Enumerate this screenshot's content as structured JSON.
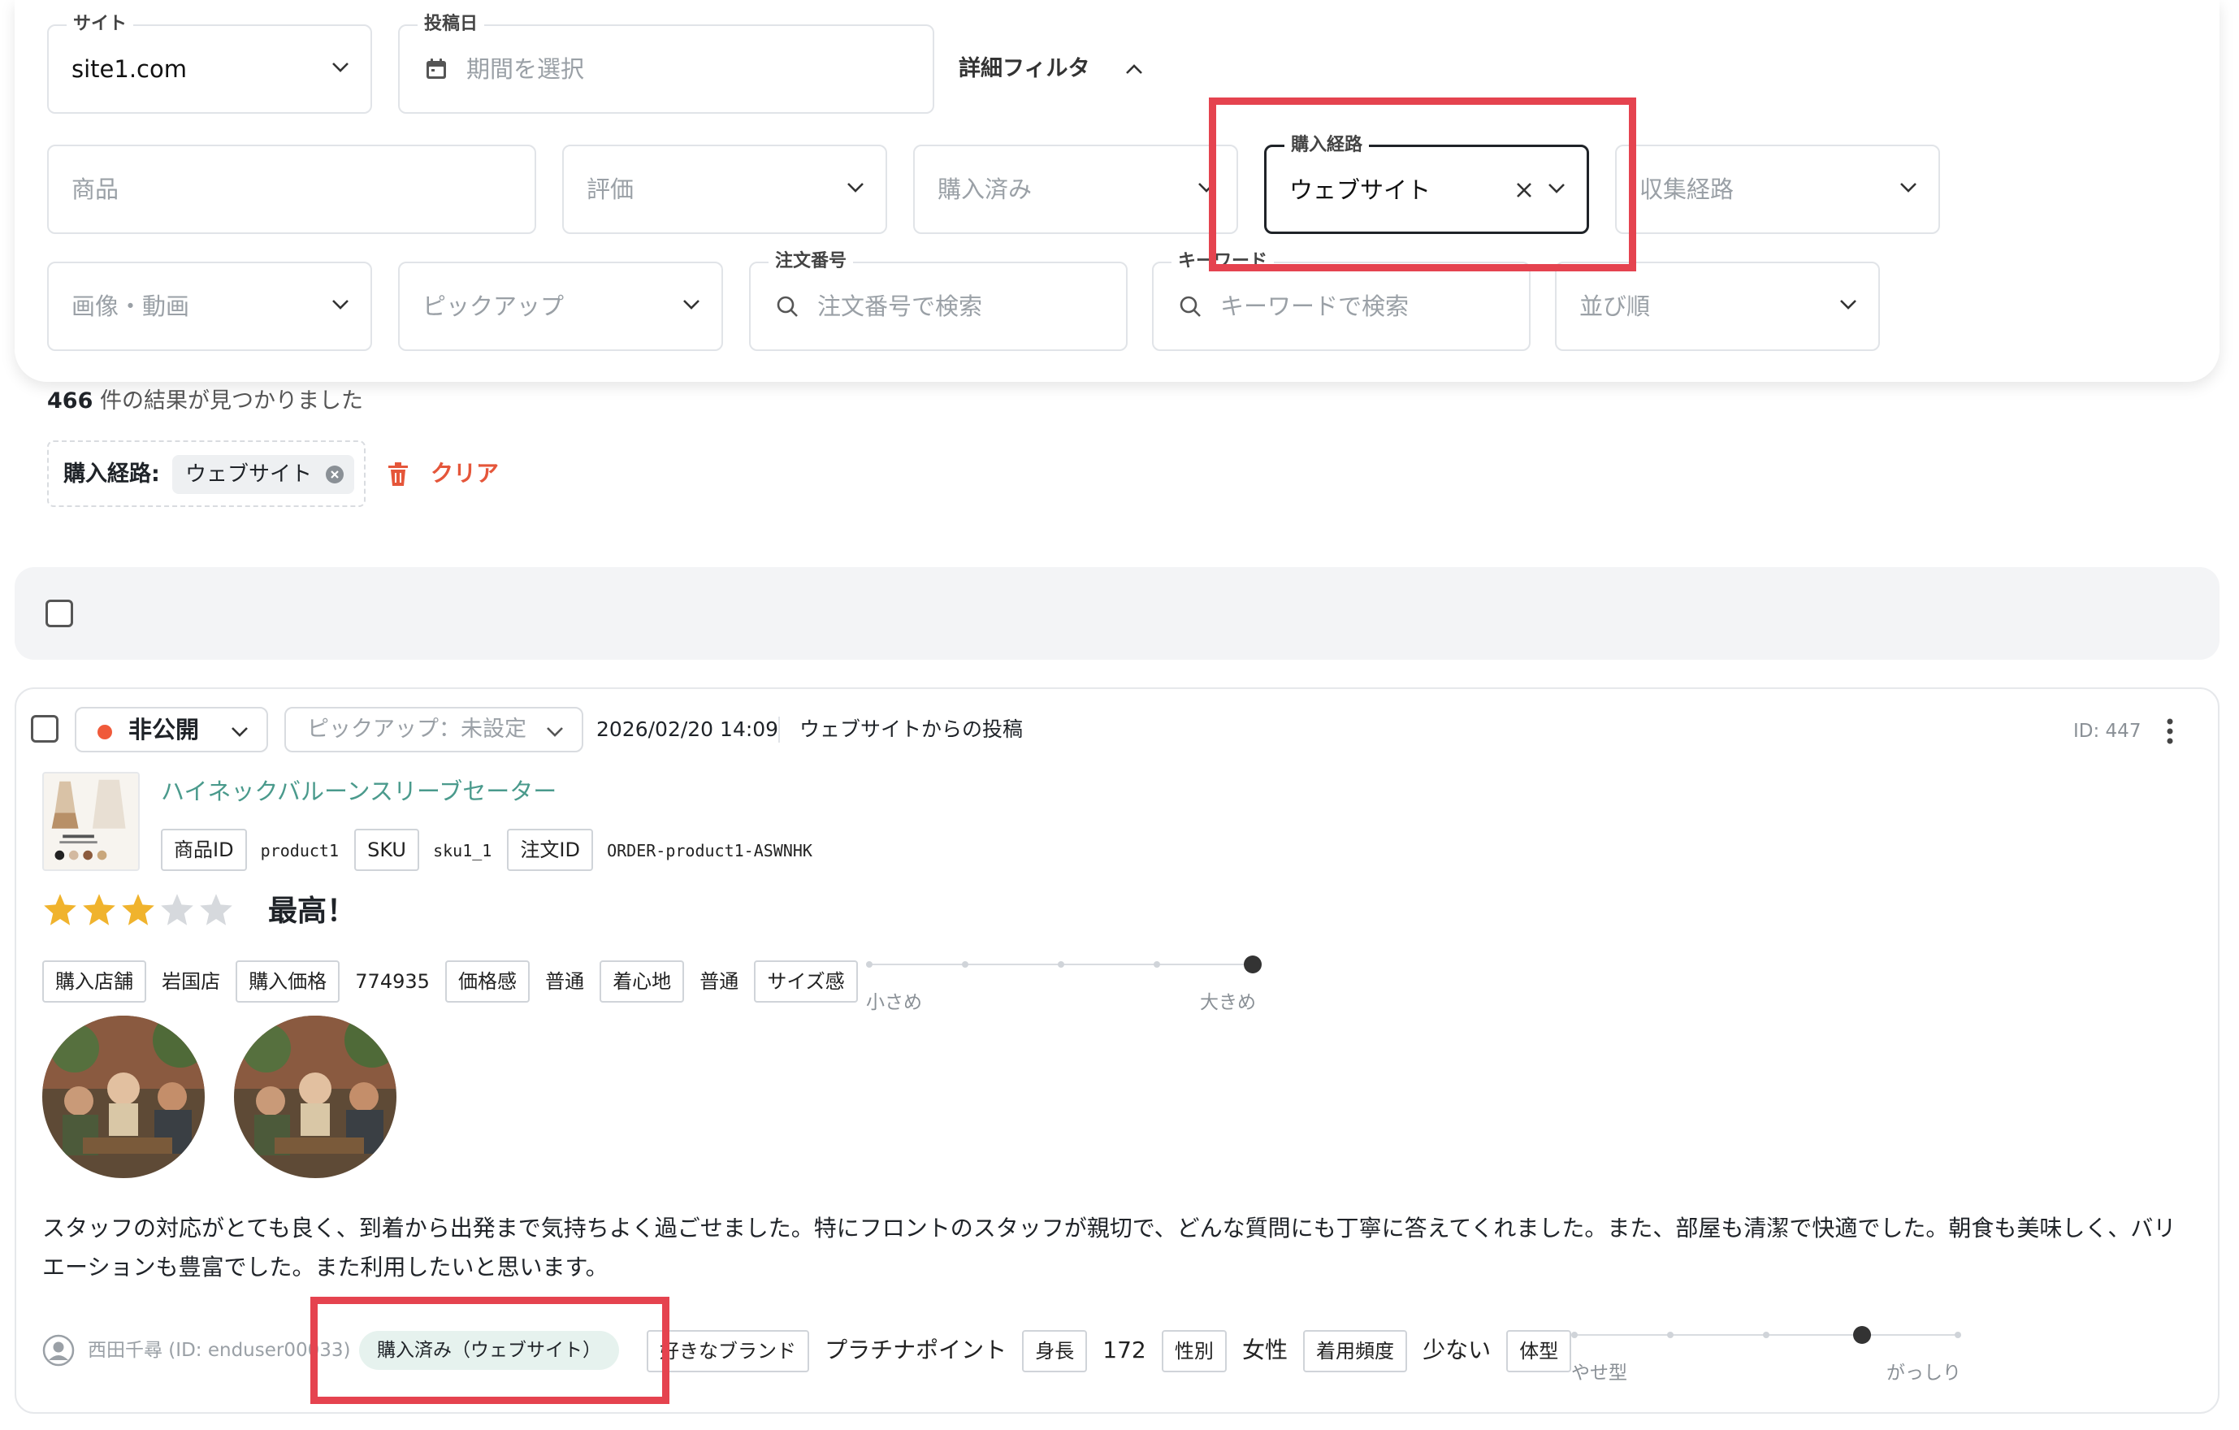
{
  "filters": {
    "site": {
      "label": "サイト",
      "value": "site1.com"
    },
    "posted_date": {
      "label": "投稿日",
      "placeholder": "期間を選択"
    },
    "advanced_toggle": "詳細フィルタ",
    "product": {
      "placeholder": "商品"
    },
    "rating": {
      "placeholder": "評価"
    },
    "purchased": {
      "placeholder": "購入済み"
    },
    "purchase_route": {
      "label": "購入経路",
      "value": "ウェブサイト"
    },
    "collection_route": {
      "placeholder": "収集経路"
    },
    "media": {
      "placeholder": "画像・動画"
    },
    "pickup": {
      "placeholder": "ピックアップ"
    },
    "order_number": {
      "label": "注文番号",
      "placeholder": "注文番号で検索"
    },
    "keyword": {
      "label": "キーワード",
      "placeholder": "キーワードで検索"
    },
    "sort": {
      "placeholder": "並び順"
    }
  },
  "results": {
    "count": "466",
    "suffix": "件の結果が見つかりました"
  },
  "active_filters": {
    "label": "購入経路:",
    "chip": "ウェブサイト",
    "clear": "クリア"
  },
  "review": {
    "status": "非公開",
    "pickup": "ピックアップ：未設定",
    "datetime": "2026/02/20 14:09",
    "source": "ウェブサイトからの投稿",
    "id": "ID: 447",
    "product_name": "ハイネックバルーンスリーブセーター",
    "meta": [
      {
        "key": "商品ID",
        "value": "product1"
      },
      {
        "key": "SKU",
        "value": "sku1_1"
      },
      {
        "key": "注文ID",
        "value": "ORDER-product1-ASWNHK"
      }
    ],
    "rating": 3,
    "rating_max": 5,
    "title": "最高！",
    "attributes": [
      {
        "key": "購入店舗",
        "value": "岩国店"
      },
      {
        "key": "購入価格",
        "value": "774935"
      },
      {
        "key": "価格感",
        "value": "普通"
      },
      {
        "key": "着心地",
        "value": "普通"
      }
    ],
    "size_scale": {
      "label": "サイズ感",
      "min": "小さめ",
      "max": "大きめ",
      "position": 5,
      "steps": 5
    },
    "body_line1": "スタッフの対応がとても良く、到着から出発まで気持ちよく過ごせました。特にフロントのスタッフが親切で、どんな質問にも丁寧に答えてくれました。また、部屋も清潔で快適でした。朝食も美味しく、バリ",
    "body_line2": "エーションも豊富でした。また利用したいと思います。",
    "user": "西田千尋 (ID: enduser00033)",
    "purchase_badge": "購入済み（ウェブサイト）",
    "favorite_brand": "好きなブランド",
    "favorite_brand_value": "プラチナポイント",
    "height_label": "身長",
    "height_value": "172",
    "gender_label": "性別",
    "gender_value": "女性",
    "freq_label": "着用頻度",
    "freq_value": "少ない",
    "body_type": {
      "label": "体型",
      "min": "やせ型",
      "max": "がっしり",
      "position": 4,
      "steps": 5
    }
  },
  "colors": {
    "accent_red": "#e5434f",
    "status_dot": "#f05a3a",
    "star": "#f0b32d",
    "star_empty": "#d6d9dd",
    "link": "#4a9a8c",
    "badge_bg": "#e6f2ee"
  }
}
